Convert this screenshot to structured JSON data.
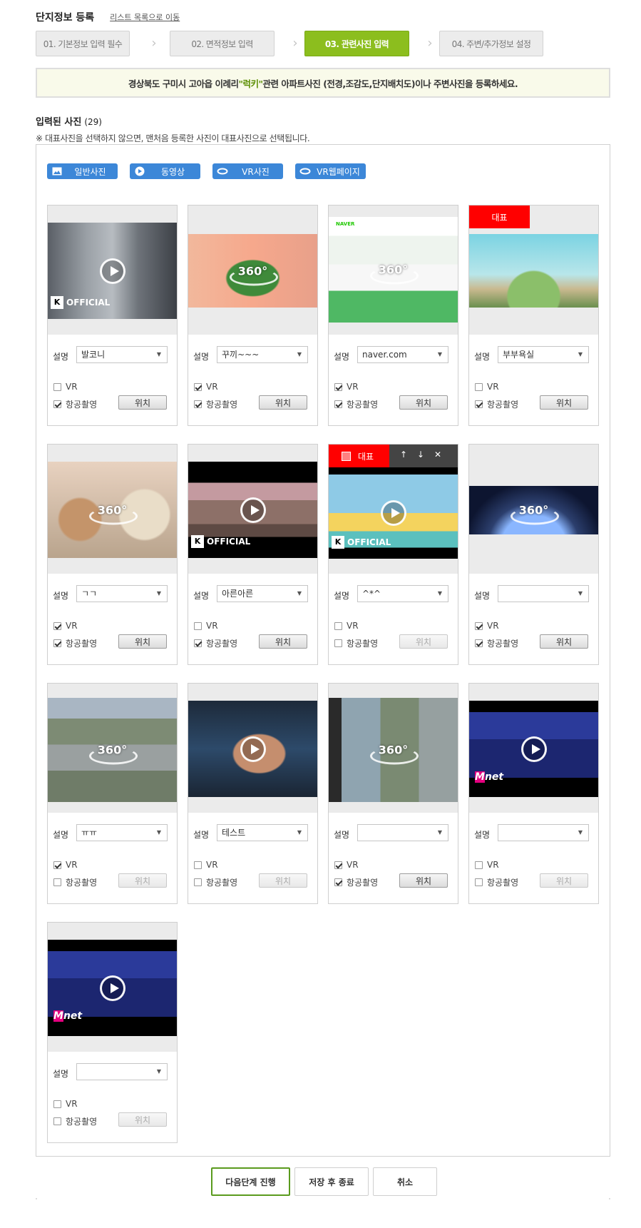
{
  "header": {
    "title": "단지정보 등록",
    "list_link": "리스트 목록으로 이동"
  },
  "steps": [
    {
      "label": "01. 기본정보 입력 필수",
      "active": false
    },
    {
      "label": "02. 면적정보 입력",
      "active": false
    },
    {
      "label": "03. 관련사진 입력",
      "active": true
    },
    {
      "label": "04. 주변/추가정보 설정",
      "active": false
    }
  ],
  "notice": {
    "prefix": "경상북도 구미시 고아읍 이례리 ",
    "highlight": "\"럭키\"",
    "suffix": " 관련 아파트사진 (전경,조감도,단지배치도)이나 주변사진을 등록하세요."
  },
  "photos": {
    "title": "입력된 사진",
    "count": "(29)",
    "note": "※ 대표사진을 선택하지 않으면, 맨처음 등록한 사진이 대표사진으로 선택됩니다."
  },
  "upload_buttons": [
    {
      "label": "일반사진",
      "icon": "image-icon"
    },
    {
      "label": "동영상",
      "icon": "play-circle-icon"
    },
    {
      "label": "VR사진",
      "icon": "vr-icon"
    },
    {
      "label": "VR웹페이지",
      "icon": "vr-web-icon"
    }
  ],
  "labels": {
    "desc": "설명",
    "vr": "VR",
    "aerial": "항공촬영",
    "position": "위치",
    "rep": "대표",
    "official": "OFFICIAL",
    "mnet": "Mnet",
    "naver": "NAVER"
  },
  "cards": [
    {
      "desc": "발코니",
      "vr": false,
      "aerial": true,
      "position_enabled": true,
      "media": "video",
      "rep": false
    },
    {
      "desc": "꾸끼~~~",
      "vr": true,
      "aerial": true,
      "position_enabled": true,
      "media": "vr",
      "rep": false
    },
    {
      "desc": "naver.com",
      "vr": true,
      "aerial": true,
      "position_enabled": true,
      "media": "vrweb",
      "rep": false
    },
    {
      "desc": "부부욕실",
      "vr": false,
      "aerial": true,
      "position_enabled": true,
      "media": "photo",
      "rep": true
    },
    {
      "desc": "ㄱㄱ",
      "vr": true,
      "aerial": true,
      "position_enabled": true,
      "media": "vr",
      "rep": false
    },
    {
      "desc": "아른아른",
      "vr": false,
      "aerial": true,
      "position_enabled": true,
      "media": "video",
      "rep": false
    },
    {
      "desc": "^*^",
      "vr": false,
      "aerial": false,
      "position_enabled": false,
      "media": "video",
      "rep": true,
      "rep_controls": true
    },
    {
      "desc": "",
      "vr": true,
      "aerial": true,
      "position_enabled": true,
      "media": "vr",
      "rep": false
    },
    {
      "desc": "ㅠㅠ",
      "vr": true,
      "aerial": false,
      "position_enabled": false,
      "media": "vr",
      "rep": false
    },
    {
      "desc": "테스트",
      "vr": false,
      "aerial": false,
      "position_enabled": false,
      "media": "video",
      "rep": false
    },
    {
      "desc": "",
      "vr": true,
      "aerial": true,
      "position_enabled": true,
      "media": "vr",
      "rep": false
    },
    {
      "desc": "",
      "vr": false,
      "aerial": false,
      "position_enabled": false,
      "media": "video",
      "rep": false
    },
    {
      "desc": "",
      "vr": false,
      "aerial": false,
      "position_enabled": false,
      "media": "video",
      "rep": false
    }
  ],
  "footer": {
    "next": "다음단계 진행",
    "save_exit": "저장 후 종료",
    "cancel": "취소"
  },
  "colors": {
    "accent_green": "#8cbe1e",
    "button_blue": "#3c87d8",
    "rep_red": "#ff0000",
    "notice_bg": "#f9faea"
  }
}
